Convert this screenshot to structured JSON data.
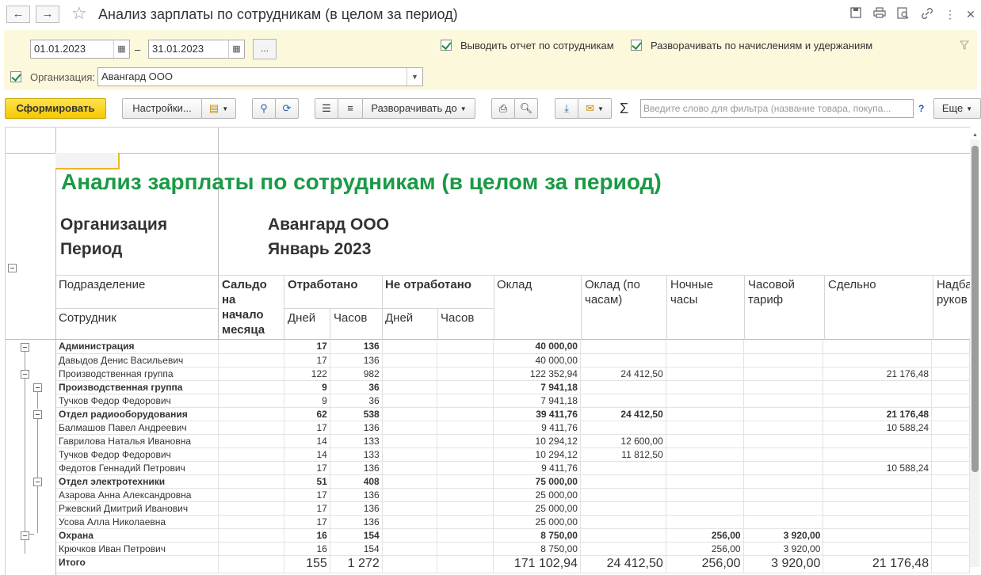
{
  "window": {
    "title": "Анализ зарплаты по сотрудникам (в целом за период)",
    "back_icon": "←",
    "forward_icon": "→",
    "toolbar_icons": [
      "save-icon",
      "print-icon",
      "preview-icon",
      "link-icon",
      "more-icon",
      "close-icon"
    ]
  },
  "filter": {
    "date_from": "01.01.2023",
    "date_to": "31.01.2023",
    "dash": "–",
    "dots": "...",
    "show_by_employee_label": "Выводить отчет по сотрудникам",
    "expand_label": "Разворачивать по начислениям и удержаниям",
    "org_label": "Организация:",
    "org_value": "Авангард ООО"
  },
  "toolbar": {
    "generate_label": "Сформировать",
    "settings_label": "Настройки...",
    "expand_to_label": "Разворачивать до",
    "sigma": "Σ",
    "search_placeholder": "Введите слово для фильтра (название товара, покупа...",
    "help": "?",
    "more_label": "Еще"
  },
  "report": {
    "title": "Анализ зарплаты по сотрудникам (в целом за период)",
    "org_label": "Организация",
    "org_value": "Авангард ООО",
    "period_label": "Период",
    "period_value": "Январь 2023",
    "headers": {
      "division": "Подразделение",
      "employee": "Сотрудник",
      "balance": "Сальдо на начало месяца",
      "worked": "Отработано",
      "not_worked": "Не отработано",
      "days": "Дней",
      "hours": "Часов",
      "salary": "Оклад",
      "salary_hours": "Оклад (по часам)",
      "night": "Ночные часы",
      "hourly": "Часовой тариф",
      "piece": "Сдельно",
      "bonus": "Надба руков"
    }
  },
  "rows": [
    {
      "name": "Администрация",
      "bold": true,
      "days": "17",
      "hours": "136",
      "salary": "40 000,00",
      "sal_hours": "",
      "night": "",
      "hourly": "",
      "piece": ""
    },
    {
      "name": "Давыдов Денис Васильевич",
      "bold": false,
      "days": "17",
      "hours": "136",
      "salary": "40 000,00",
      "sal_hours": "",
      "night": "",
      "hourly": "",
      "piece": ""
    },
    {
      "name": "Производственная группа",
      "bold": false,
      "days": "122",
      "hours": "982",
      "salary": "122 352,94",
      "sal_hours": "24 412,50",
      "night": "",
      "hourly": "",
      "piece": "21 176,48"
    },
    {
      "name": "Производственная группа",
      "bold": true,
      "days": "9",
      "hours": "36",
      "salary": "7 941,18",
      "sal_hours": "",
      "night": "",
      "hourly": "",
      "piece": ""
    },
    {
      "name": "Тучков Федор Федорович",
      "bold": false,
      "days": "9",
      "hours": "36",
      "salary": "7 941,18",
      "sal_hours": "",
      "night": "",
      "hourly": "",
      "piece": ""
    },
    {
      "name": "Отдел радиооборудования",
      "bold": true,
      "days": "62",
      "hours": "538",
      "salary": "39 411,76",
      "sal_hours": "24 412,50",
      "night": "",
      "hourly": "",
      "piece": "21 176,48"
    },
    {
      "name": "Балмашов Павел Андреевич",
      "bold": false,
      "days": "17",
      "hours": "136",
      "salary": "9 411,76",
      "sal_hours": "",
      "night": "",
      "hourly": "",
      "piece": "10 588,24"
    },
    {
      "name": "Гаврилова Наталья Ивановна",
      "bold": false,
      "days": "14",
      "hours": "133",
      "salary": "10 294,12",
      "sal_hours": "12 600,00",
      "night": "",
      "hourly": "",
      "piece": ""
    },
    {
      "name": "Тучков Федор Федорович",
      "bold": false,
      "days": "14",
      "hours": "133",
      "salary": "10 294,12",
      "sal_hours": "11 812,50",
      "night": "",
      "hourly": "",
      "piece": ""
    },
    {
      "name": "Федотов Геннадий Петрович",
      "bold": false,
      "days": "17",
      "hours": "136",
      "salary": "9 411,76",
      "sal_hours": "",
      "night": "",
      "hourly": "",
      "piece": "10 588,24"
    },
    {
      "name": "Отдел электротехники",
      "bold": true,
      "days": "51",
      "hours": "408",
      "salary": "75 000,00",
      "sal_hours": "",
      "night": "",
      "hourly": "",
      "piece": ""
    },
    {
      "name": "Азарова Анна Александровна",
      "bold": false,
      "days": "17",
      "hours": "136",
      "salary": "25 000,00",
      "sal_hours": "",
      "night": "",
      "hourly": "",
      "piece": ""
    },
    {
      "name": "Ржевский Дмитрий Иванович",
      "bold": false,
      "days": "17",
      "hours": "136",
      "salary": "25 000,00",
      "sal_hours": "",
      "night": "",
      "hourly": "",
      "piece": ""
    },
    {
      "name": "Усова Алла Николаевна",
      "bold": false,
      "days": "17",
      "hours": "136",
      "salary": "25 000,00",
      "sal_hours": "",
      "night": "",
      "hourly": "",
      "piece": ""
    },
    {
      "name": "Охрана",
      "bold": true,
      "days": "16",
      "hours": "154",
      "salary": "8 750,00",
      "sal_hours": "",
      "night": "256,00",
      "hourly": "3 920,00",
      "piece": ""
    },
    {
      "name": "Крючков Иван Петрович",
      "bold": false,
      "days": "16",
      "hours": "154",
      "salary": "8 750,00",
      "sal_hours": "",
      "night": "256,00",
      "hourly": "3 920,00",
      "piece": ""
    }
  ],
  "total": {
    "label": "Итого",
    "days": "155",
    "hours": "1 272",
    "salary": "171 102,94",
    "sal_hours": "24 412,50",
    "night": "256,00",
    "hourly": "3 920,00",
    "piece": "21 176,48"
  },
  "colors": {
    "title_green": "#1a9a46",
    "filter_bg": "#fbf8dc",
    "primary_button": "#f5c800"
  }
}
